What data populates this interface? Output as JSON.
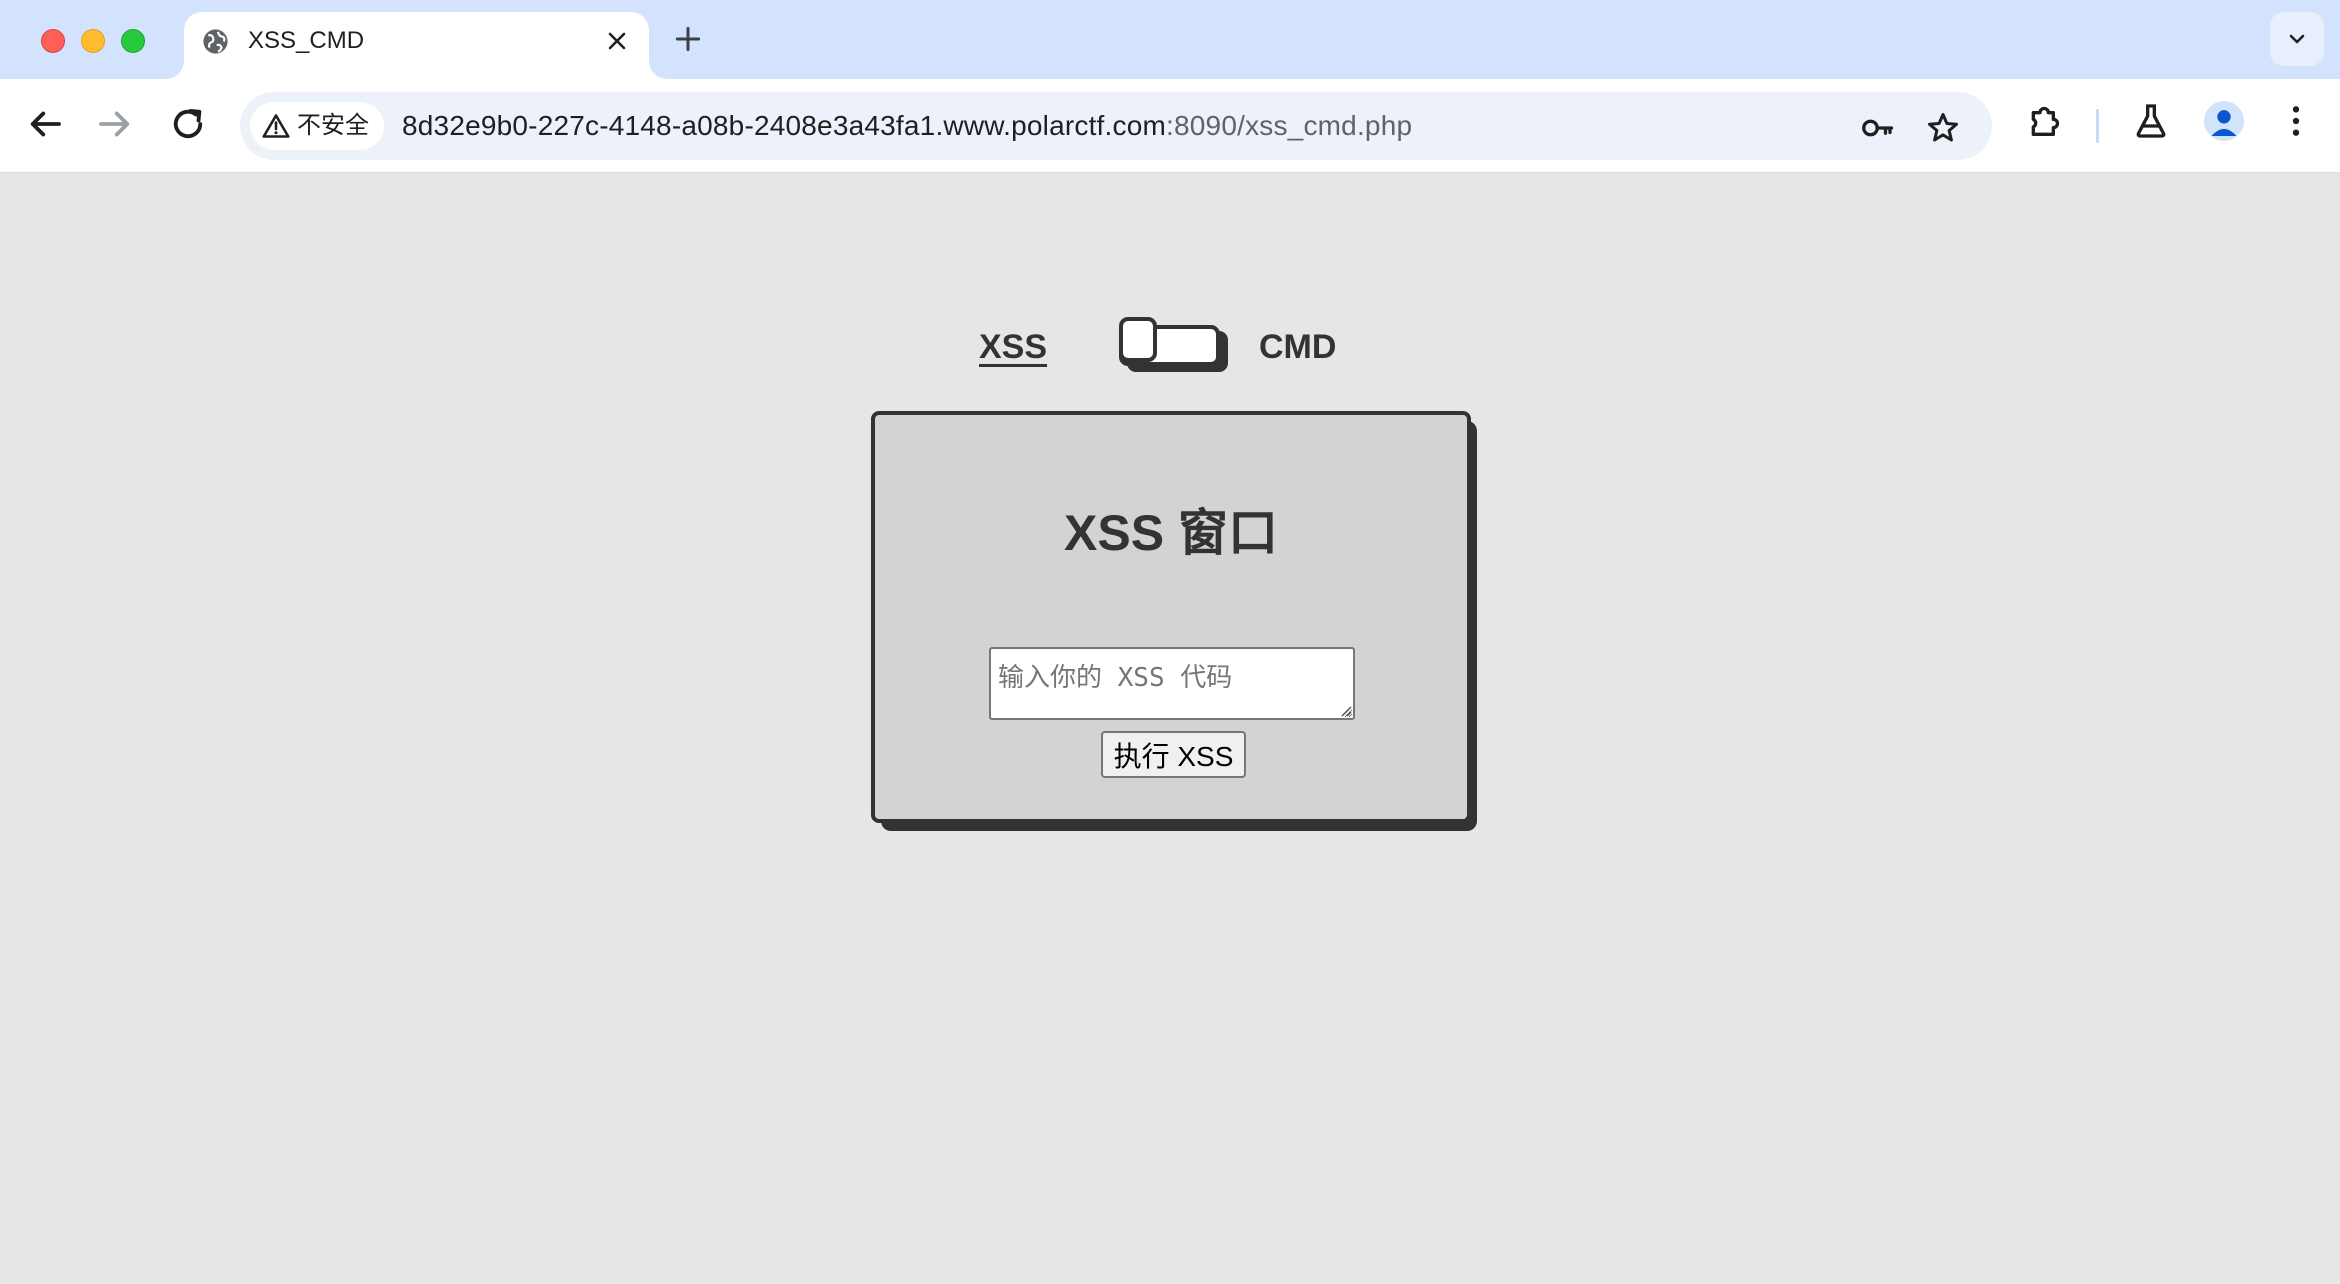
{
  "browser": {
    "tab": {
      "title": "XSS_CMD",
      "favicon": "globe-icon"
    },
    "address_bar": {
      "security_label": "不安全",
      "url_host": "8d32e9b0-227c-4148-a08b-2408e3a43fa1.www.polarctf.com",
      "url_rest": ":8090/xss_cmd.php"
    },
    "icons": [
      "back-icon",
      "forward-icon",
      "reload-icon",
      "key-icon",
      "star-icon",
      "extensions-icon",
      "labs-flask-icon",
      "profile-icon",
      "more-menu-icon"
    ]
  },
  "page": {
    "switch": {
      "left_label": "XSS",
      "right_label": "CMD",
      "state": "XSS"
    },
    "panel": {
      "title": "XSS 窗口",
      "input_placeholder": "输入你的 XSS 代码",
      "input_value": "",
      "button_label": "执行 XSS"
    }
  },
  "colors": {
    "tabbar_bg": "#d3e3fd",
    "page_bg": "#e6e6e6",
    "panel_bg": "#d3d3d3",
    "border_dark": "#333333"
  }
}
